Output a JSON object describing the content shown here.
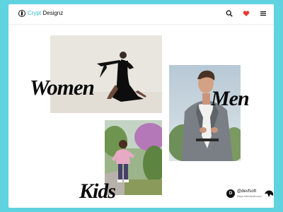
{
  "brand": {
    "accent": "Crypt",
    "rest": " Designz",
    "accent_color": "#2fb4cb"
  },
  "toolbar": {
    "icons": [
      "search-icon",
      "heart-icon",
      "menu-icon"
    ],
    "heart_color": "#e53935"
  },
  "categories": {
    "women": "Women",
    "men": "Men",
    "kids": "Kids"
  },
  "signature": {
    "badge": "D",
    "handle": "@devfsoft",
    "url": "https://devfsoft.com"
  },
  "colors": {
    "background": "#5fd3df",
    "card": "#ffffff",
    "text": "#0a0a0a"
  }
}
